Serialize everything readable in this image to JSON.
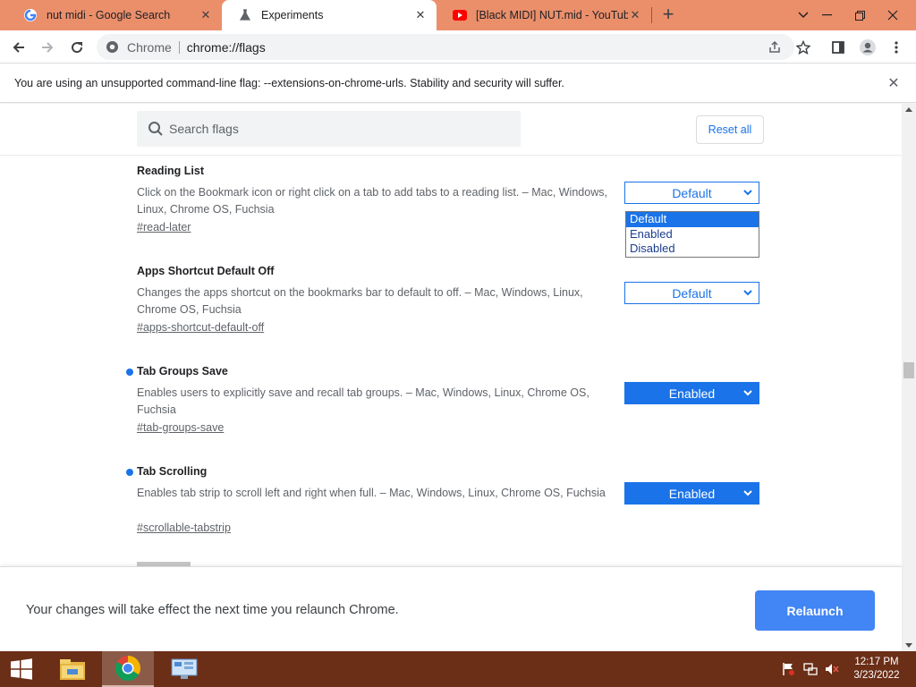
{
  "tabs": [
    {
      "title": "nut midi - Google Search",
      "icon": "google-icon",
      "active": false
    },
    {
      "title": "Experiments",
      "icon": "flask-icon",
      "active": true
    },
    {
      "title": "[Black MIDI] NUT.mid - YouTube",
      "icon": "youtube-icon",
      "active": false
    }
  ],
  "omnibox": {
    "site": "Chrome",
    "url": "chrome://flags"
  },
  "infobar": {
    "message": "You are using an unsupported command-line flag: --extensions-on-chrome-urls. Stability and security will suffer."
  },
  "search": {
    "placeholder": "Search flags",
    "reset_label": "Reset all"
  },
  "flags": [
    {
      "title": "Reading List",
      "description": "Click on the Bookmark icon or right click on a tab to add tabs to a reading list. – Mac, Windows, Linux, Chrome OS, Fuchsia",
      "link": "#read-later",
      "value": "Default",
      "modified": false
    },
    {
      "title": "Apps Shortcut Default Off",
      "description": "Changes the apps shortcut on the bookmarks bar to default to off. – Mac, Windows, Linux, Chrome OS, Fuchsia",
      "link": "#apps-shortcut-default-off",
      "value": "Default",
      "modified": false
    },
    {
      "title": "Tab Groups Save",
      "description": "Enables users to explicitly save and recall tab groups. – Mac, Windows, Linux, Chrome OS, Fuchsia",
      "link": "#tab-groups-save",
      "value": "Enabled",
      "modified": true
    },
    {
      "title": "Tab Scrolling",
      "description": "Enables tab strip to scroll left and right when full. – Mac, Windows, Linux, Chrome OS, Fuchsia",
      "link": "#scrollable-tabstrip",
      "value": "Enabled",
      "modified": true
    }
  ],
  "dropdown": {
    "options": [
      "Default",
      "Enabled",
      "Disabled"
    ],
    "selected": "Default"
  },
  "relaunch": {
    "message": "Your changes will take effect the next time you relaunch Chrome.",
    "button": "Relaunch"
  },
  "taskbar": {
    "time": "12:17 PM",
    "date": "3/23/2022"
  },
  "colors": {
    "accent": "#1a73e8",
    "tabstrip": "#eb8f6b",
    "taskbar": "#6b2e17",
    "relaunch": "#4285f4"
  }
}
